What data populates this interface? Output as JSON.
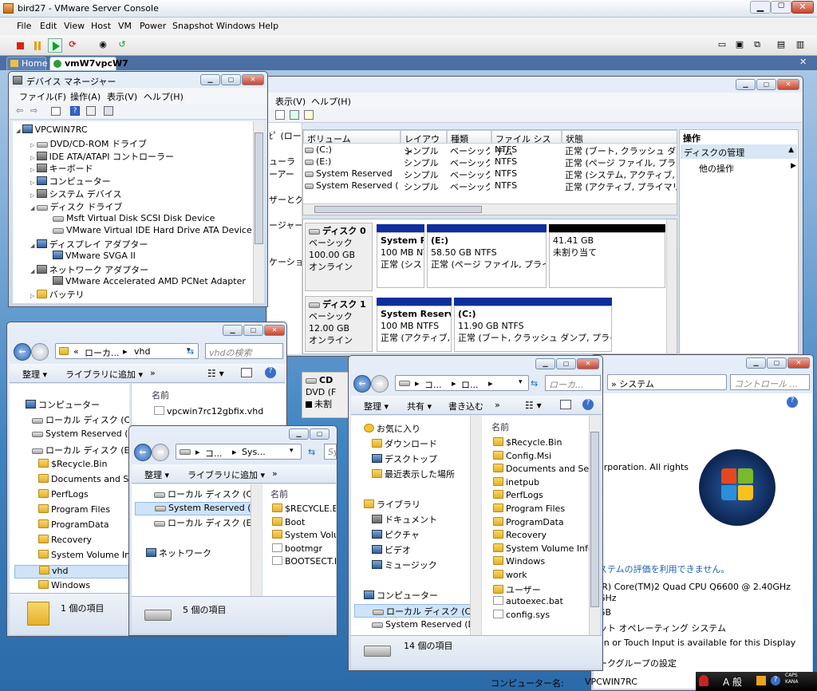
{
  "vm": {
    "title": "bird27 - VMware Server Console",
    "menu": [
      "File",
      "Edit",
      "View",
      "Host",
      "VM",
      "Power",
      "Snapshot",
      "Windows",
      "Help"
    ],
    "tabs": [
      "Home",
      "vmW7vpcW7"
    ]
  },
  "devmgr": {
    "title": "デバイス マネージャー",
    "menu": [
      "ファイル(F)",
      "操作(A)",
      "表示(V)",
      "ヘルプ(H)"
    ],
    "tree": [
      "VPCWIN7RC",
      "DVD/CD-ROM ドライブ",
      "IDE ATA/ATAPI コントローラー",
      "キーボード",
      "コンピューター",
      "システム デバイス",
      "ディスク ドライブ",
      "Msft Virtual Disk SCSI Disk Device",
      "VMware Virtual IDE Hard Drive ATA Device",
      "ディスプレイ アダプター",
      "VMware SVGA II",
      "ネットワーク アダプター",
      "VMware Accelerated AMD PCNet Adapter",
      "バッテリ"
    ]
  },
  "diskmgmt": {
    "menu": [
      "表示(V)",
      "ヘルプ(H)"
    ],
    "left_labels": [
      "ﾋﾟ (ローカ",
      "ューラ",
      "ーアー",
      "ザーとグ",
      "ージャー",
      "ケーショ"
    ],
    "headers": [
      "ボリューム",
      "レイアウト",
      "種類",
      "ファイル システム",
      "状態"
    ],
    "rows": [
      [
        "(C:)",
        "シンプル",
        "ベーシック",
        "NTFS",
        "正常 (ブート, クラッシュ ダンプ"
      ],
      [
        "(E:)",
        "シンプル",
        "ベーシック",
        "NTFS",
        "正常 (ページ ファイル, プライマ"
      ],
      [
        "System Reserved",
        "シンプル",
        "ベーシック",
        "NTFS",
        "正常 (システム, アクティブ, プラ"
      ],
      [
        "System Reserved (D:)",
        "シンプル",
        "ベーシック",
        "NTFS",
        "正常 (アクティブ, プライマリ パ"
      ]
    ],
    "disk0": {
      "name": "ディスク 0",
      "type": "ベーシック",
      "size": "100.00 GB",
      "status": "オンライン",
      "parts": [
        [
          "System Re",
          "100 MB NT",
          "正常 (シス"
        ],
        [
          "(E:)",
          "58.50 GB NTFS",
          "正常 (ページ ファイル, プライマ"
        ],
        [
          "",
          "41.41 GB",
          "未割り当て"
        ]
      ]
    },
    "disk1": {
      "name": "ディスク 1",
      "type": "ベーシック",
      "size": "12.00 GB",
      "status": "オンライン",
      "parts": [
        [
          "System Reserved",
          "100 MB NTFS",
          "正常 (アクティブ, プ"
        ],
        [
          "(C:)",
          "11.90 GB NTFS",
          "正常 (ブート, クラッシュ ダンプ, プライマ!"
        ]
      ]
    },
    "cd": {
      "name": "CD",
      "line2": "DVD (F"
    },
    "legend": "未割",
    "ops": {
      "title": "操作",
      "item1": "ディスクの管理",
      "item2": "他の操作"
    }
  },
  "explorer1": {
    "addr": [
      "«",
      "ローカ...",
      "vhd"
    ],
    "search": "vhdの検索",
    "cmd": [
      "整理 ▾",
      "ライブラリに追加 ▾",
      "»"
    ],
    "nav": [
      "コンピューター",
      "ローカル ディスク (C:)",
      "System Reserved (D:)",
      "ローカル ディスク (E:)",
      "$Recycle.Bin",
      "Documents and Setti",
      "PerfLogs",
      "Program Files",
      "ProgramData",
      "Recovery",
      "System Volume Infor",
      "vhd",
      "Windows"
    ],
    "col": "名前",
    "files": [
      "vpcwin7rc12gbfix.vhd"
    ],
    "status": "1 個の項目"
  },
  "explorer2": {
    "addr": [
      "コ...",
      "Sys..."
    ],
    "search": "Syst",
    "cmd": [
      "整理 ▾",
      "ライブラリに追加 ▾",
      "»"
    ],
    "nav": [
      "ローカル ディスク (C:)",
      "System Reserved (D:)",
      "ローカル ディスク (E:)",
      "ネットワーク"
    ],
    "col": "名前",
    "files": [
      "$RECYCLE.BIN",
      "Boot",
      "System Volume I",
      "bootmgr",
      "BOOTSECT.BAK"
    ],
    "status": "5 個の項目"
  },
  "explorer3": {
    "addr": [
      "コ...",
      "ロ..."
    ],
    "search": "ローカ...",
    "cmd": [
      "整理 ▾",
      "共有 ▾",
      "書き込む",
      "»"
    ],
    "nav": [
      "お気に入り",
      "ダウンロード",
      "デスクトップ",
      "最近表示した場所",
      "ライブラリ",
      "ドキュメント",
      "ピクチャ",
      "ビデオ",
      "ミュージック",
      "コンピューター",
      "ローカル ディスク (C:)",
      "System Reserved (D:)"
    ],
    "col": "名前",
    "files": [
      "$Recycle.Bin",
      "Config.Msi",
      "Documents and Setting",
      "inetpub",
      "PerfLogs",
      "Program Files",
      "ProgramData",
      "Recovery",
      "System Volume Inform",
      "Windows",
      "work",
      "ユーザー",
      "autoexec.bat",
      "config.sys"
    ],
    "status": "14 個の項目"
  },
  "sysprops": {
    "addr": "» システム",
    "search": "コントロール ...",
    "copyright": "orporation.  All rights",
    "rating": "ステムの評価を利用できません。",
    "cpu": "(R) Core(TM)2 Quad CPU    Q6600  @ 2.40GHz",
    "ghz": "GHz",
    "gb": "GB",
    "os": "ット オペレーティング システム",
    "pen": "en or Touch Input is available for this Display",
    "wg": "ークグループの設定",
    "cname_label": "コンピューター名:",
    "cname": "VPCWIN7RC",
    "v_link": "v"
  },
  "taskbar": {
    "ime": "A 般",
    "caps": "CAPS\nKANA"
  }
}
